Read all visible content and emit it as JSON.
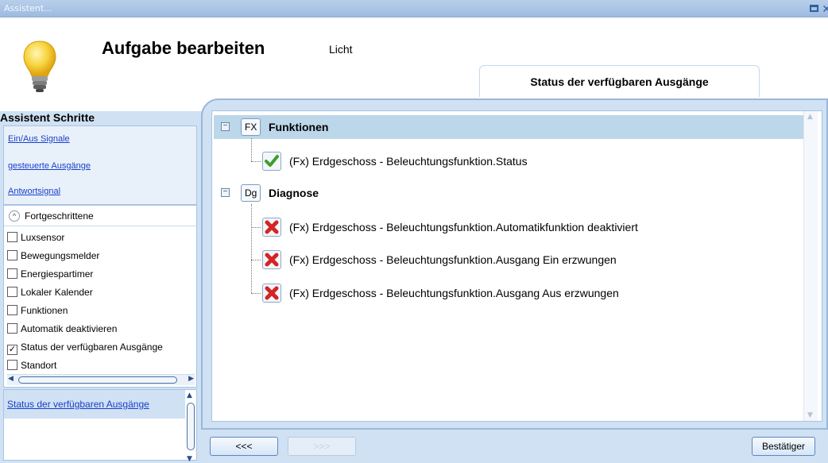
{
  "window": {
    "title": "Assistent..."
  },
  "header": {
    "title": "Aufgabe bearbeiten",
    "subtitle": "Licht",
    "tab": "Status der verfügbaren Ausgänge"
  },
  "sidebar": {
    "title": "Assistent Schritte",
    "steps": [
      {
        "label": "Ein/Aus Signale"
      },
      {
        "label": "gesteuerte Ausgänge"
      },
      {
        "label": "Antwortsignal"
      }
    ],
    "advanced": {
      "label": "Fortgeschrittene",
      "items": [
        {
          "label": "Luxsensor",
          "checked": false
        },
        {
          "label": "Bewegungsmelder",
          "checked": false
        },
        {
          "label": "Energiespartimer",
          "checked": false
        },
        {
          "label": "Lokaler Kalender",
          "checked": false
        },
        {
          "label": "Funktionen",
          "checked": false
        },
        {
          "label": "Automatik deaktivieren",
          "checked": false
        },
        {
          "label": "Status der verfügbaren Ausgänge",
          "checked": true
        },
        {
          "label": "Standort",
          "checked": false
        }
      ]
    },
    "current_step": "Status der verfügbaren Ausgänge"
  },
  "tree": {
    "groups": [
      {
        "badge": "FX",
        "label": "Funktionen",
        "items": [
          {
            "label": "(Fx) Erdgeschoss - Beleuchtungsfunktion.Status",
            "status": "ok"
          }
        ]
      },
      {
        "badge": "Dg",
        "label": "Diagnose",
        "items": [
          {
            "label": "(Fx) Erdgeschoss - Beleuchtungsfunktion.Automatikfunktion deaktiviert",
            "status": "error"
          },
          {
            "label": "(Fx) Erdgeschoss - Beleuchtungsfunktion.Ausgang Ein erzwungen",
            "status": "error"
          },
          {
            "label": "(Fx) Erdgeschoss - Beleuchtungsfunktion.Ausgang Aus erzwungen",
            "status": "error"
          }
        ]
      }
    ]
  },
  "footer": {
    "back_label": "<<<",
    "next_label": ">>>",
    "confirm_label": "Bestätiger"
  },
  "colors": {
    "accent": "#9ab8dc",
    "selection": "#bcd6ea",
    "link": "#1a3fc9",
    "ok": "#3aa02a",
    "error": "#d42424"
  }
}
